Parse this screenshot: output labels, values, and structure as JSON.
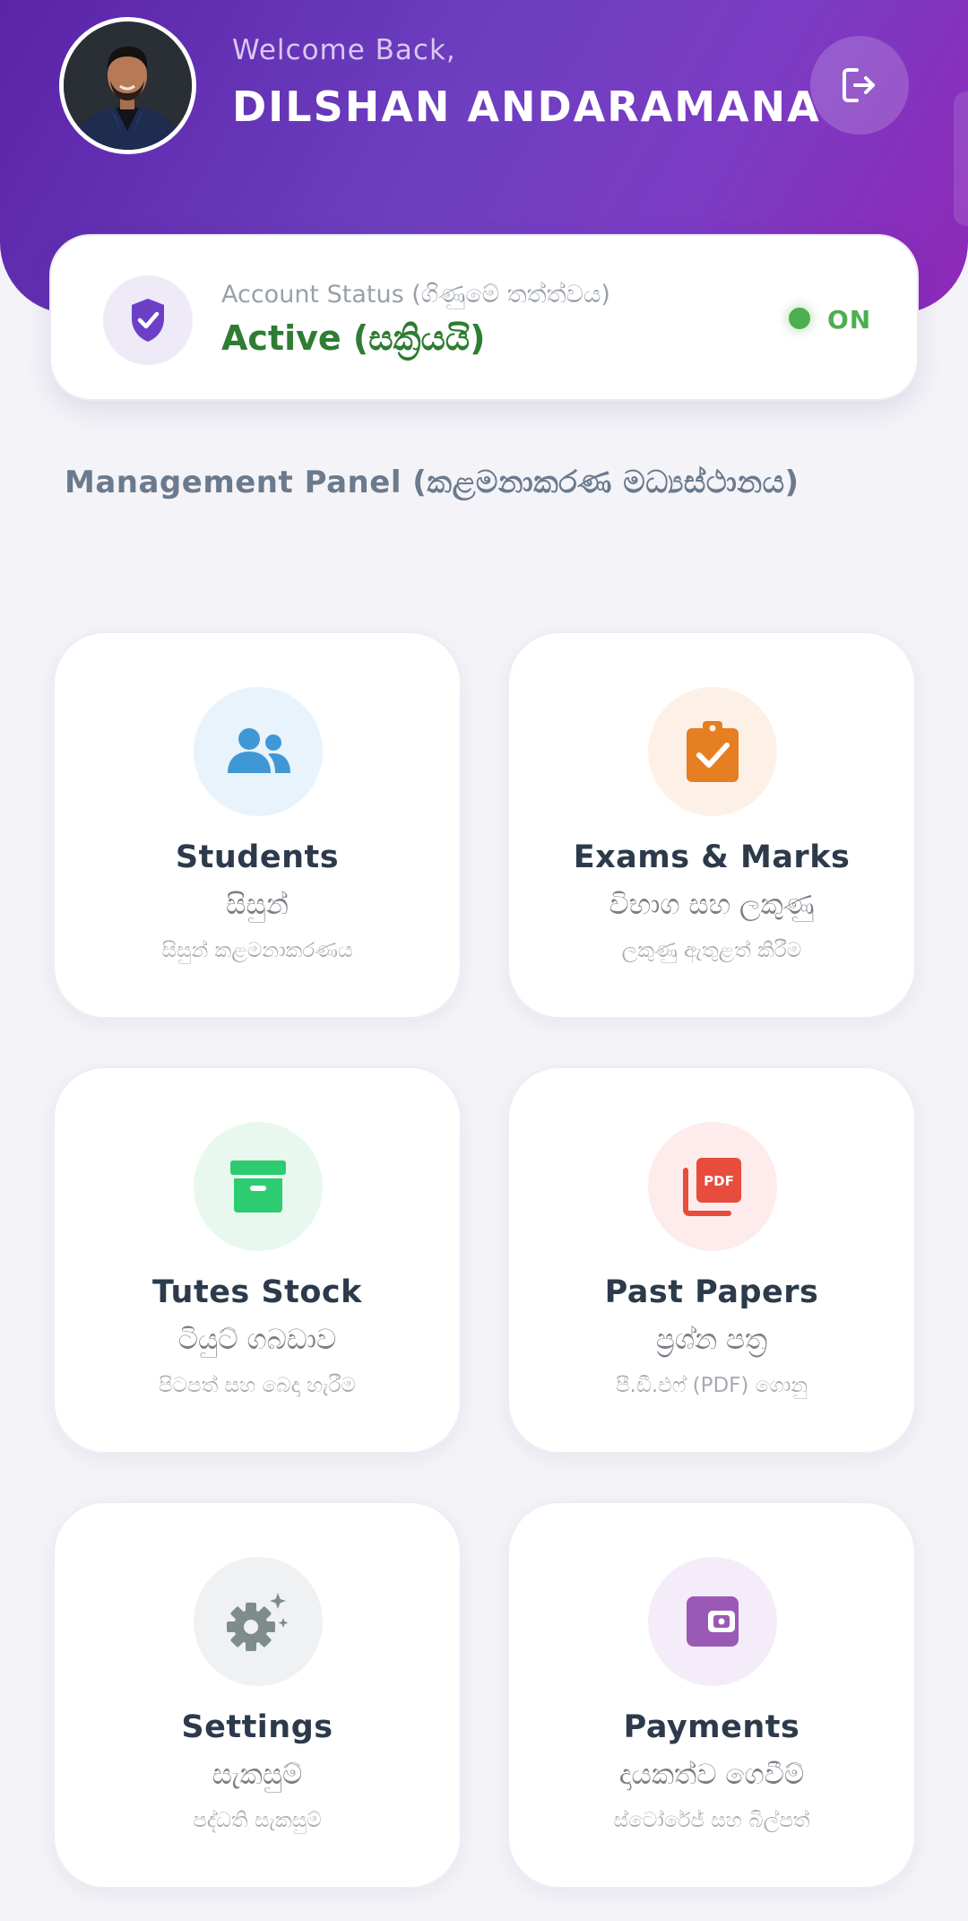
{
  "header": {
    "welcome": "Welcome Back,",
    "username": "DILSHAN ANDARAMANA",
    "logout_icon": "logout-icon"
  },
  "status": {
    "label": "Account Status (ගිණුමේ තත්ත්වය)",
    "value": "Active (සක්‍රියයි)",
    "indicator": "ON",
    "indicator_color": "#4caf50",
    "value_color": "#2e7d32"
  },
  "section": {
    "title": "Management Panel (කළමනාකරණ මධ්‍යස්ථානය)"
  },
  "cards": [
    {
      "title": "Students",
      "sub": "සිසුන්",
      "desc": "සිසුන් කළමනාකරණය",
      "icon": "users-icon",
      "color": "#3f97d6",
      "bg": "#e9f3fb"
    },
    {
      "title": "Exams & Marks",
      "sub": "විභාග සහ ලකුණු",
      "desc": "ලකුණු ඇතුළත් කිරීම",
      "icon": "clipboard-check-icon",
      "color": "#e67e22",
      "bg": "#fdf1e7"
    },
    {
      "title": "Tutes Stock",
      "sub": "ටියුට් ගබඩාව",
      "desc": "පිටපත් සහ බෙදා හැරීම",
      "icon": "archive-box-icon",
      "color": "#2ecc71",
      "bg": "#e9f8ef"
    },
    {
      "title": "Past Papers",
      "sub": "ප්‍රශ්න පත්‍ර",
      "desc": "පී.ඩී.එෆ් (PDF) ගොනු",
      "icon": "pdf-file-icon",
      "color": "#e74c3c",
      "bg": "#fdeceb"
    },
    {
      "title": "Settings",
      "sub": "සැකසුම්",
      "desc": "පද්ධති සැකසුම්",
      "icon": "gear-icon",
      "color": "#7f8c8d",
      "bg": "#f0f1f2"
    },
    {
      "title": "Payments",
      "sub": "දායකත්ව ගෙවීම්",
      "desc": "ස්ටෝරේජ් සහ බිල්පත්",
      "icon": "wallet-icon",
      "color": "#9b59b6",
      "bg": "#f4ecf8"
    }
  ],
  "colors": {
    "header_gradient_start": "#5b23a8",
    "header_gradient_end": "#8e28b8",
    "background": "#f4f3f8"
  }
}
